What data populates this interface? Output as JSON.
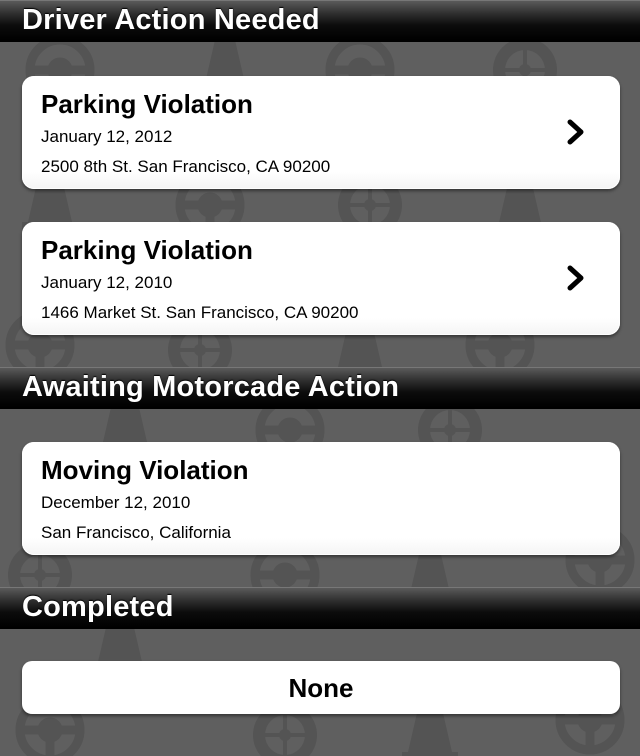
{
  "sections": [
    {
      "title": "Driver Action Needed",
      "items": [
        {
          "title": "Parking Violation",
          "date": "January 12, 2012",
          "location": "2500 8th St. San Francisco, CA 90200",
          "icon": "chevron-right-icon"
        },
        {
          "title": "Parking Violation",
          "date": "January 12, 2010",
          "location": "1466 Market St. San Francisco, CA 90200",
          "icon": "chevron-right-icon"
        }
      ]
    },
    {
      "title": "Awaiting Motorcade Action",
      "items": [
        {
          "title": "Moving Violation",
          "date": "December 12, 2010",
          "location": "San Francisco, California"
        }
      ]
    },
    {
      "title": "Completed",
      "empty_label": "None"
    }
  ],
  "background": {
    "color": "#5f5f5f",
    "pattern_icons": [
      "steering-wheel-icon",
      "traffic-cone-icon",
      "tire-icon",
      "seat-icon"
    ]
  },
  "colors": {
    "header_bg": "#000000",
    "header_text": "#ffffff",
    "card_bg": "#ffffff",
    "card_text": "#000000"
  }
}
